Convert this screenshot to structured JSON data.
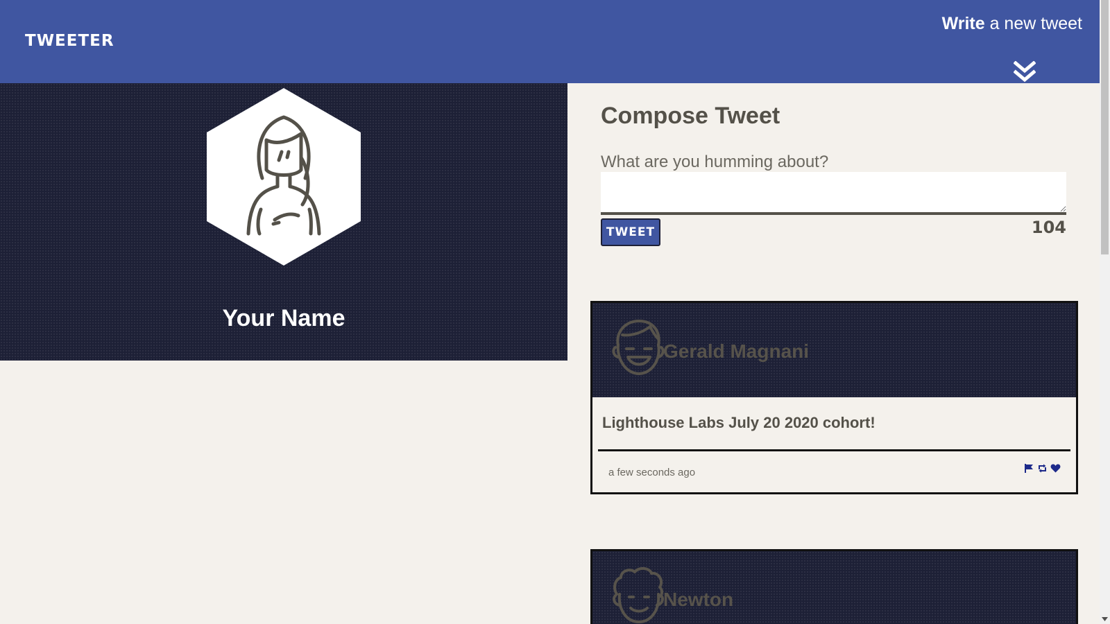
{
  "nav": {
    "brand": "TWEETER",
    "write_bold": "Write",
    "write_rest": " a new tweet"
  },
  "profile": {
    "name": "Your Name"
  },
  "compose": {
    "title": "Compose Tweet",
    "label": "What are you humming about?",
    "button_label": "TWEET",
    "counter": "104"
  },
  "tweets": [
    {
      "author": "Gerald Magnani",
      "text": "Lighthouse Labs July 20 2020 cohort!",
      "time": "a few seconds ago"
    },
    {
      "author": "Newton"
    }
  ],
  "colors": {
    "nav_bg": "#4056a1",
    "dark_bg": "#1d2036",
    "page_bg": "#f4f1ec",
    "text": "#545149"
  },
  "icons": [
    "chevron-double-down-icon",
    "flag-icon",
    "retweet-icon",
    "heart-icon",
    "scroll-down-icon"
  ]
}
